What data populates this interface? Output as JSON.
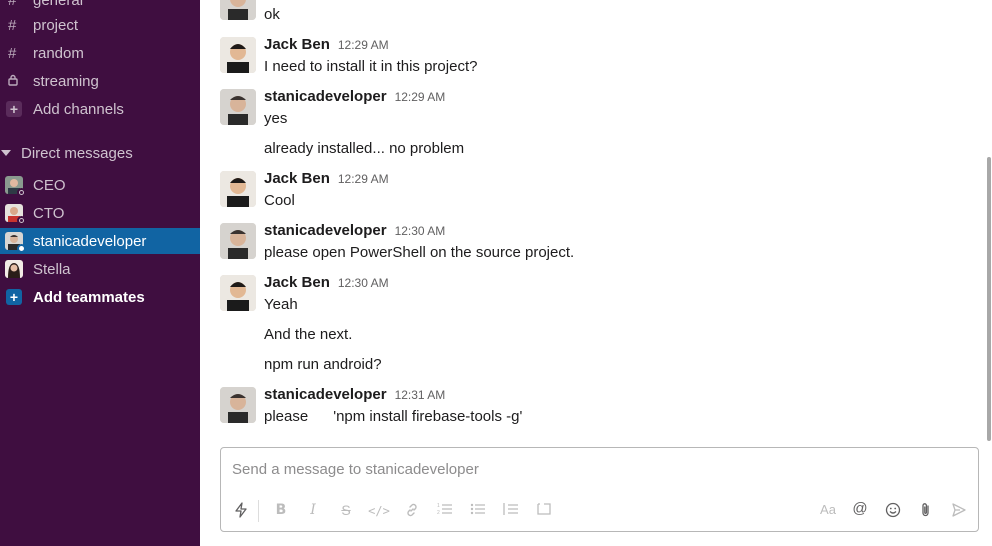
{
  "sidebar": {
    "channels": [
      {
        "glyph": "#",
        "label": "general",
        "icon": "hash-icon"
      },
      {
        "glyph": "#",
        "label": "project",
        "icon": "hash-icon"
      },
      {
        "glyph": "#",
        "label": "random",
        "icon": "hash-icon"
      },
      {
        "glyph": "🔒",
        "label": "streaming",
        "icon": "lock-icon"
      }
    ],
    "add_channels": "Add channels",
    "dm_header": "Direct messages",
    "dms": [
      {
        "label": "CEO"
      },
      {
        "label": "CTO"
      },
      {
        "label": "stanicadeveloper"
      },
      {
        "label": "Stella"
      }
    ],
    "add_teammates": "Add teammates"
  },
  "messages": [
    {
      "text": "ok"
    },
    {
      "name": "Jack Ben",
      "time": "12:29 AM",
      "text": "I need to install it in this project?"
    },
    {
      "name": "stanicadeveloper",
      "time": "12:29 AM",
      "text": "yes"
    },
    {
      "text": "already installed... no problem"
    },
    {
      "name": "Jack Ben",
      "time": "12:29 AM",
      "text": "Cool"
    },
    {
      "name": "stanicadeveloper",
      "time": "12:30 AM",
      "text": "please open PowerShell on the source project."
    },
    {
      "name": "Jack Ben",
      "time": "12:30 AM",
      "text": "Yeah"
    },
    {
      "text": "And the next."
    },
    {
      "text": "npm run android?"
    },
    {
      "name": "stanicadeveloper",
      "time": "12:31 AM",
      "text": "please      'npm install firebase-tools -g'"
    }
  ],
  "composer": {
    "placeholder": "Send a message to stanicadeveloper",
    "format_label": "Aa",
    "mention_label": "@"
  },
  "colors": {
    "sidebar_bg": "#3f0e40",
    "active_bg": "#1164a3"
  }
}
